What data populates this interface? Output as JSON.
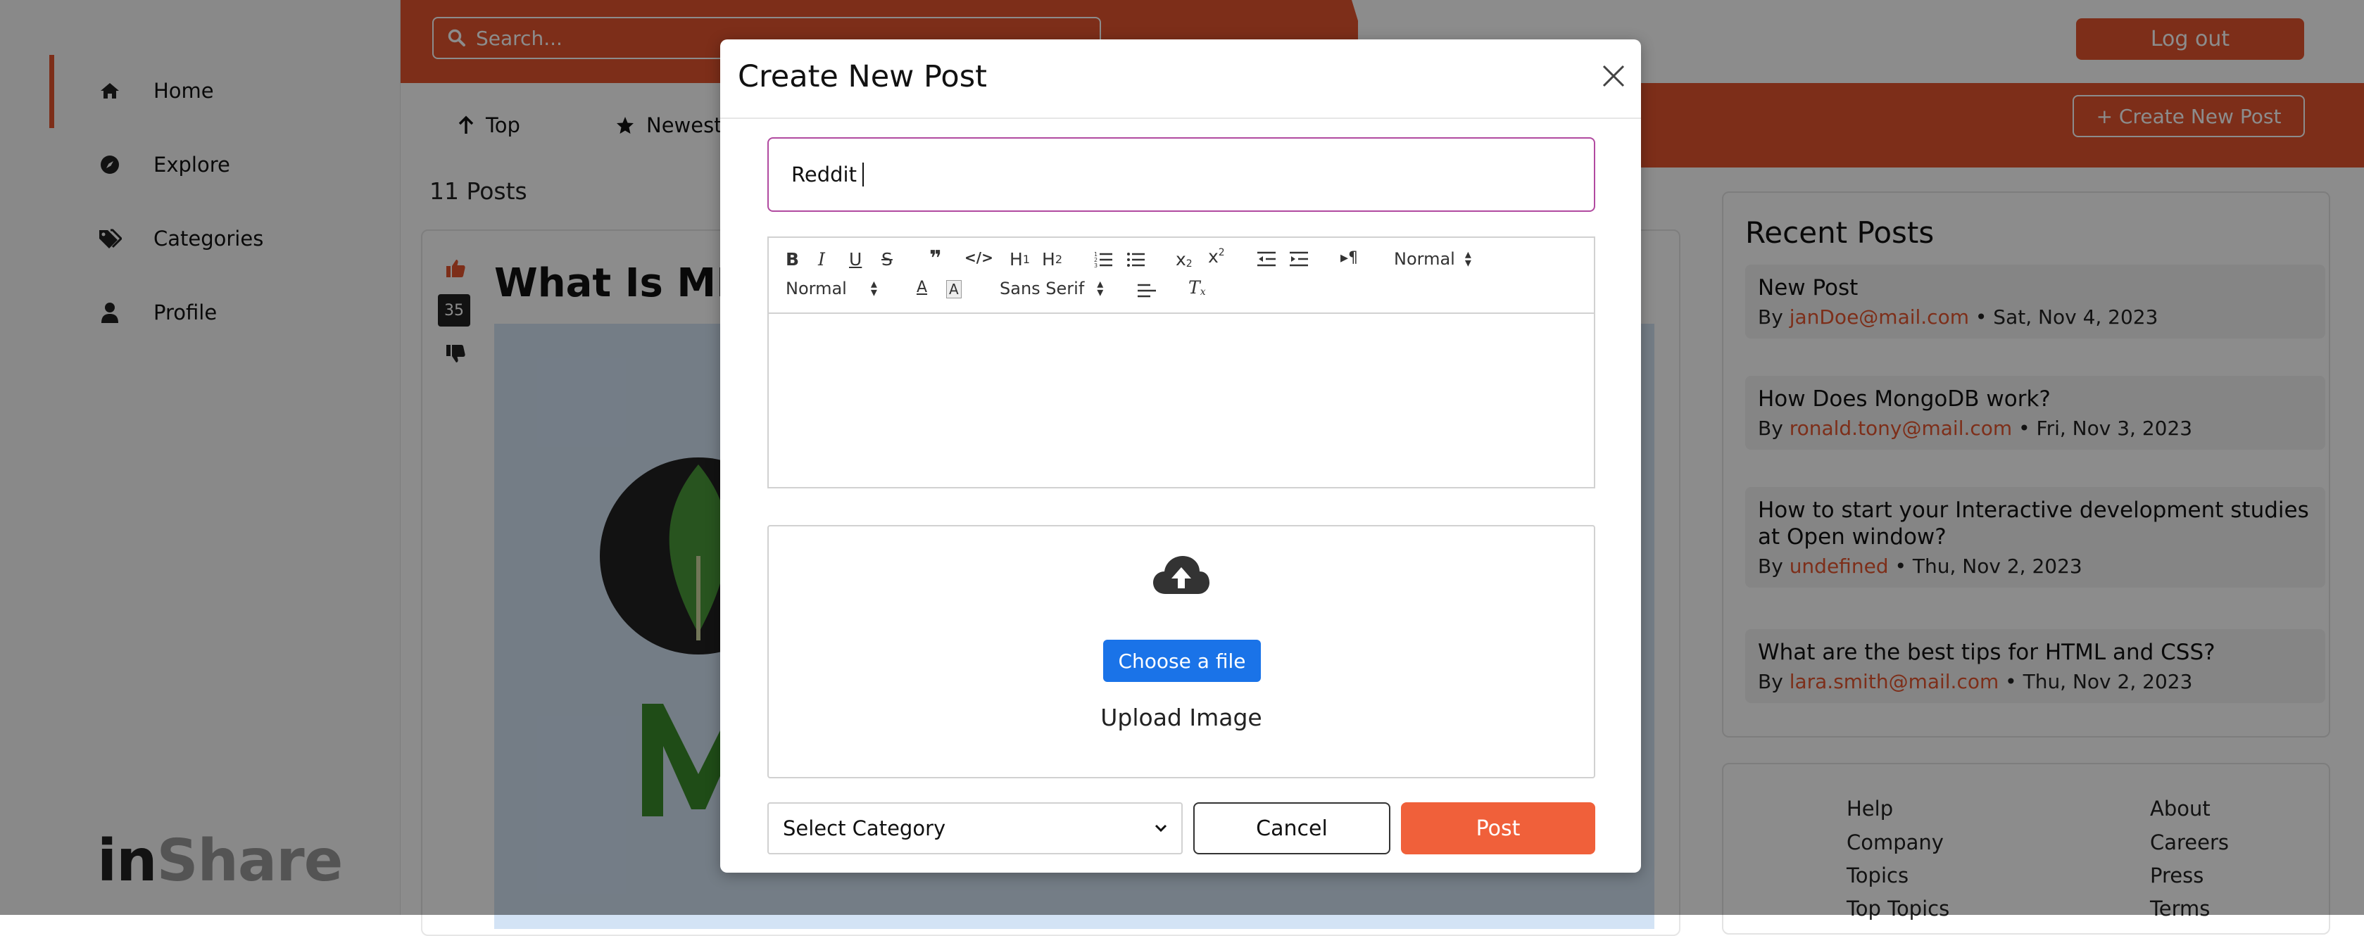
{
  "app": {
    "logo_part1": "in",
    "logo_part2": "Share"
  },
  "sidebar": {
    "items": [
      {
        "label": "Home",
        "icon": "home-icon",
        "active": true
      },
      {
        "label": "Explore",
        "icon": "compass-icon"
      },
      {
        "label": "Categories",
        "icon": "tags-icon"
      },
      {
        "label": "Profile",
        "icon": "user-icon"
      }
    ]
  },
  "header": {
    "search_placeholder": "Search...",
    "logout_label": "Log out"
  },
  "filters": {
    "top_label": "Top",
    "newest_label": "Newest",
    "create_post_label": "+ Create New Post"
  },
  "feed": {
    "posts_count": "11 Posts",
    "first_post": {
      "title": "What Is MER",
      "votes": "35"
    }
  },
  "recent": {
    "title": "Recent Posts",
    "items": [
      {
        "title": "New Post",
        "by": "By",
        "author": "janDoe@mail.com",
        "date": "• Sat, Nov 4, 2023"
      },
      {
        "title": "How Does MongoDB work?",
        "by": "By",
        "author": "ronald.tony@mail.com",
        "date": "• Fri, Nov 3, 2023"
      },
      {
        "title": "How to start your Interactive development studies at Open window?",
        "by": "By",
        "author": "undefined",
        "date": "• Thu, Nov 2, 2023"
      },
      {
        "title": "What are the best tips for HTML and CSS?",
        "by": "By",
        "author": "lara.smith@mail.com",
        "date": "• Thu, Nov 2, 2023"
      }
    ]
  },
  "footer": {
    "col1": [
      "Help",
      "Company",
      "Topics",
      "Top Topics"
    ],
    "col2": [
      "About",
      "Careers",
      "Press",
      "Terms"
    ]
  },
  "modal": {
    "title": "Create New Post",
    "title_input_value": "Reddit",
    "toolbar": {
      "size_select": "Normal",
      "header_select": "Normal",
      "font_select": "Sans Serif"
    },
    "choose_file_label": "Choose a file",
    "upload_label": "Upload Image",
    "category_placeholder": "Select Category",
    "cancel_label": "Cancel",
    "post_label": "Post"
  },
  "colors": {
    "accent": "#e4552e",
    "post_button": "#f0603a",
    "file_button": "#1a73e8",
    "input_focus": "#b14aa0"
  }
}
